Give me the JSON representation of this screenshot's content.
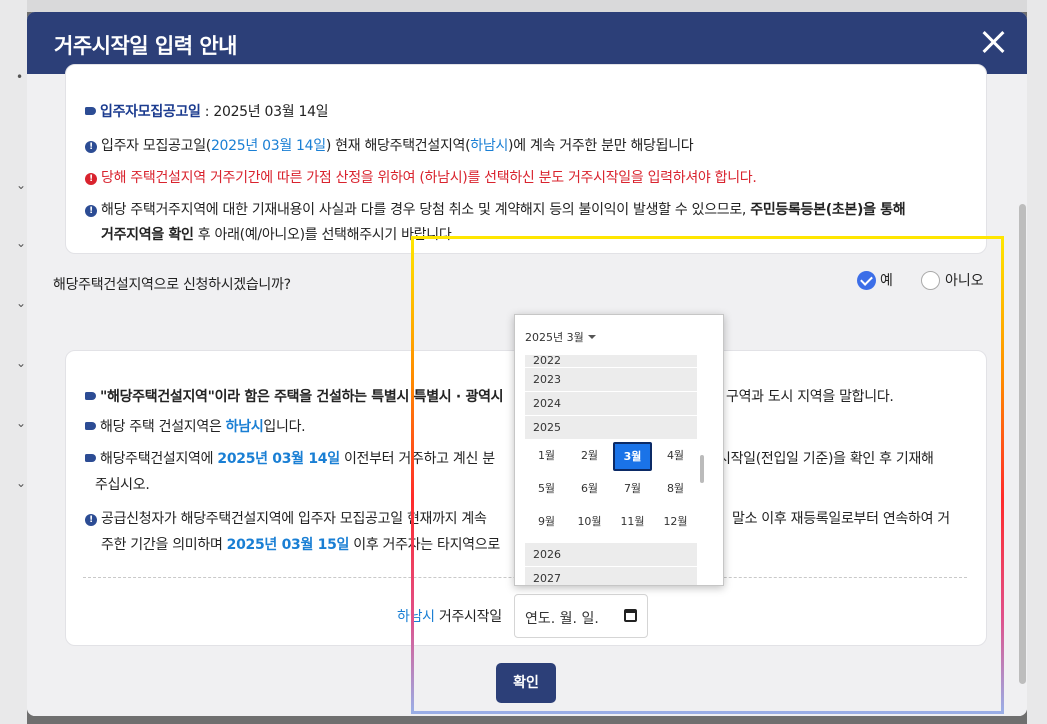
{
  "background": {
    "ticks": [
      "•",
      "⌄",
      "⌄",
      "⌄",
      "⌄",
      "⌄",
      "⌄"
    ]
  },
  "modal": {
    "title": "거주시작일 입력 안내"
  },
  "notice": {
    "line1_label": "입주자모집공고일",
    "line1_value": " : 2025년 03월 14일",
    "line2_a": "입주자 모집공고일(",
    "line2_date": "2025년 03월 14일",
    "line2_b": ") 현재 해당주택건설지역(",
    "line2_city": "하남시",
    "line2_c": ")에 계속 거주한 분만 해당됩니다",
    "line3": "당해 주택건설지역 거주기간에 따른 가점 산정을 위하여 (하남시)를 선택하신 분도 거주시작일을 입력하셔야 합니다.",
    "line4_a": "해당 주택거주지역에 대한 기재내용이 사실과 다를 경우 당첨 취소 및 계약해지 등의 불이익이 발생할 수 있으므로, ",
    "line4_b": "주민등록등본(초본)을 통해",
    "line5_a": "거주지역을 확인",
    "line5_b": " 후 아래(예/아니오)를 선택해주시기 바랍니다."
  },
  "question": {
    "text": "해당주택건설지역으로 신청하시겠습니까?",
    "yes": "예",
    "no": "아니오"
  },
  "detail": {
    "d1_a": "\"해당주택건설지역\"이라 함은 주택을 건설하는 특별시 특별시 · 광역시",
    "d1_b": "구역과 도시 지역을 말합니다.",
    "d2_a": "해당 주택 건설지역은 ",
    "d2_city": "하남시",
    "d2_b": "입니다.",
    "d3_a": "해당주택건설지역에 ",
    "d3_date": "2025년 03월 14일",
    "d3_b": " 이전부터 거주하고 계신 분",
    "d3_c": "시작일(전입일 기준)을 확인 후 기재해",
    "d4": "주십시오.",
    "d5_a": "공급신청자가 해당주택건설지역에 입주자 모집공고일 현재까지 계속",
    "d5_b": "말소 이후 재등록일로부터 연속하여 거",
    "d6_a": "주한 기간을 의미하며 ",
    "d6_date": "2025년 03월 15일",
    "d6_b": " 이후 거주자는 타지역으로"
  },
  "date_field": {
    "city": "하남시",
    "label": " 거주시작일",
    "placeholder": "연도. 월. 일."
  },
  "datepicker": {
    "header": "2025년 3월",
    "years_before": [
      "2022",
      "2023",
      "2024",
      "2025"
    ],
    "months": [
      "1월",
      "2월",
      "3월",
      "4월",
      "5월",
      "6월",
      "7월",
      "8월",
      "9월",
      "10월",
      "11월",
      "12월"
    ],
    "selected_month": "3월",
    "years_after": [
      "2026",
      "2027"
    ]
  },
  "confirm_label": "확인",
  "colors": {
    "header": "#2c3f78",
    "accent_blue": "#1a7fd4",
    "warning_red": "#d9232e",
    "selected": "#1a73e8"
  }
}
